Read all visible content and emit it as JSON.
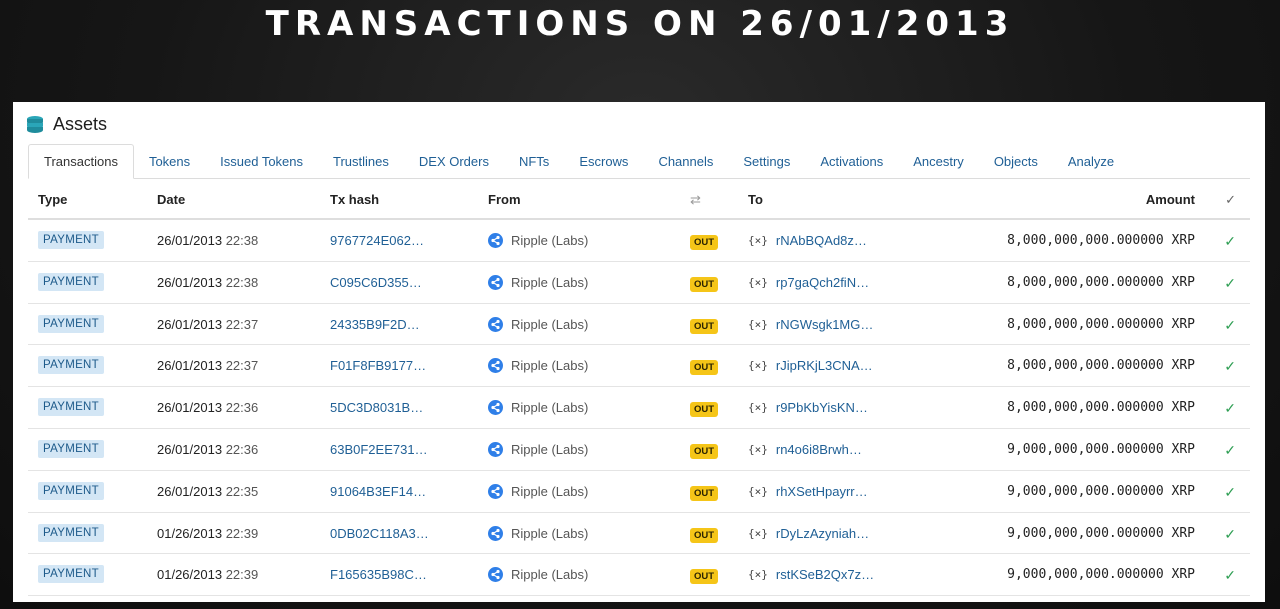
{
  "banner": {
    "title": "TRANSACTIONS ON 26/01/2013"
  },
  "panel": {
    "title": "Assets",
    "icon": "coins-stack-icon",
    "accent_color": "#1f5f95"
  },
  "tabs": [
    {
      "label": "Transactions",
      "active": true
    },
    {
      "label": "Tokens"
    },
    {
      "label": "Issued Tokens"
    },
    {
      "label": "Trustlines"
    },
    {
      "label": "DEX Orders"
    },
    {
      "label": "NFTs"
    },
    {
      "label": "Escrows"
    },
    {
      "label": "Channels"
    },
    {
      "label": "Settings"
    },
    {
      "label": "Activations"
    },
    {
      "label": "Ancestry"
    },
    {
      "label": "Objects"
    },
    {
      "label": "Analyze"
    }
  ],
  "table": {
    "headers": {
      "type": "Type",
      "date": "Date",
      "hash": "Tx hash",
      "from": "From",
      "direction_icon": "swap-icon",
      "to": "To",
      "amount": "Amount",
      "status_icon": "check-icon"
    },
    "rows": [
      {
        "type": "PAYMENT",
        "date": "26/01/2013",
        "time": "22:38",
        "hash": "9767724E062…",
        "from": "Ripple (Labs)",
        "dir": "OUT",
        "to_prefix": "{×}",
        "to": "rNAbBQAd8z…",
        "amount": "8,000,000,000.000000 XRP"
      },
      {
        "type": "PAYMENT",
        "date": "26/01/2013",
        "time": "22:38",
        "hash": "C095C6D355…",
        "from": "Ripple (Labs)",
        "dir": "OUT",
        "to_prefix": "{×}",
        "to": "rp7gaQch2fiN…",
        "amount": "8,000,000,000.000000 XRP"
      },
      {
        "type": "PAYMENT",
        "date": "26/01/2013",
        "time": "22:37",
        "hash": "24335B9F2D…",
        "from": "Ripple (Labs)",
        "dir": "OUT",
        "to_prefix": "{×}",
        "to": "rNGWsgk1MG…",
        "amount": "8,000,000,000.000000 XRP"
      },
      {
        "type": "PAYMENT",
        "date": "26/01/2013",
        "time": "22:37",
        "hash": "F01F8FB9177…",
        "from": "Ripple (Labs)",
        "dir": "OUT",
        "to_prefix": "{×}",
        "to": "rJipRKjL3CNA…",
        "amount": "8,000,000,000.000000 XRP"
      },
      {
        "type": "PAYMENT",
        "date": "26/01/2013",
        "time": "22:36",
        "hash": "5DC3D8031B…",
        "from": "Ripple (Labs)",
        "dir": "OUT",
        "to_prefix": "{×}",
        "to": "r9PbKbYisKN…",
        "amount": "8,000,000,000.000000 XRP"
      },
      {
        "type": "PAYMENT",
        "date": "26/01/2013",
        "time": "22:36",
        "hash": "63B0F2EE731…",
        "from": "Ripple (Labs)",
        "dir": "OUT",
        "to_prefix": "{×}",
        "to": "rn4o6i8Brwh…",
        "amount": "9,000,000,000.000000 XRP"
      },
      {
        "type": "PAYMENT",
        "date": "26/01/2013",
        "time": "22:35",
        "hash": "91064B3EF14…",
        "from": "Ripple (Labs)",
        "dir": "OUT",
        "to_prefix": "{×}",
        "to": "rhXSetHpayrr…",
        "amount": "9,000,000,000.000000 XRP"
      },
      {
        "type": "PAYMENT",
        "date": "01/26/2013",
        "time": "22:39",
        "hash": "0DB02C118A3…",
        "from": "Ripple (Labs)",
        "dir": "OUT",
        "to_prefix": "{×}",
        "to": "rDyLzAzyniah…",
        "amount": "9,000,000,000.000000 XRP"
      },
      {
        "type": "PAYMENT",
        "date": "01/26/2013",
        "time": "22:39",
        "hash": "F165635B98C…",
        "from": "Ripple (Labs)",
        "dir": "OUT",
        "to_prefix": "{×}",
        "to": "rstKSeB2Qx7z…",
        "amount": "9,000,000,000.000000 XRP"
      }
    ]
  }
}
